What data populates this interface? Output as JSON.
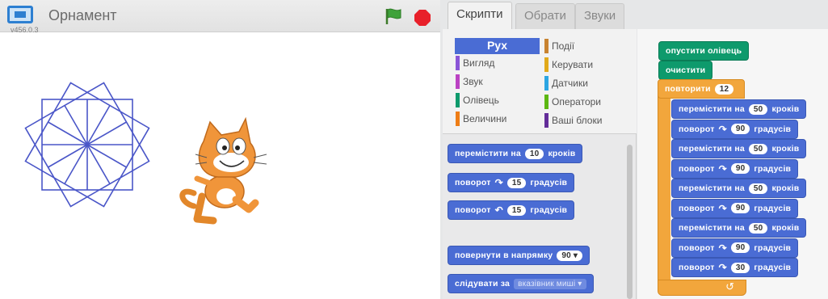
{
  "stage": {
    "title": "Орнамент",
    "version": "v456.0.3"
  },
  "tabs": [
    "Скрипти",
    "Обрати",
    "Звуки"
  ],
  "categories": {
    "motion": "Рух",
    "looks": "Вигляд",
    "sound": "Звук",
    "pen": "Олівець",
    "data": "Величини",
    "events": "Події",
    "control": "Керувати",
    "sensing": "Датчики",
    "operators": "Оператори",
    "more": "Ваші блоки"
  },
  "colors": {
    "motion": "#4a6cd4",
    "looks": "#8a55d7",
    "sound": "#bb42c3",
    "pen": "#0e9a6c",
    "data": "#ee7d16",
    "events": "#c88330",
    "control": "#e1a91a",
    "sensing": "#2ca5e2",
    "operators": "#5cb712",
    "more": "#632d99",
    "ornament": "#4a56c8"
  },
  "palette": {
    "move_prefix": "перемістити на",
    "move_value": "10",
    "move_suffix": "кроків",
    "turn_right_prefix": "поворот",
    "turn_right_value": "15",
    "turn_right_suffix": "градусів",
    "turn_left_prefix": "поворот",
    "turn_left_value": "15",
    "turn_left_suffix": "градусів",
    "point_prefix": "повернути в напрямку",
    "point_value": "90",
    "follow_prefix": "слідувати за",
    "follow_value": "вказівник миші"
  },
  "script": {
    "pen_down": "опустити олівець",
    "clear": "очистити",
    "repeat_label": "повторити",
    "repeat_count": "12",
    "move_label": "перемістити на",
    "move_value": "50",
    "move_unit": "кроків",
    "turn_label": "поворот",
    "turn_value": "90",
    "turn_unit": "градусів",
    "last_turn_value": "30"
  }
}
